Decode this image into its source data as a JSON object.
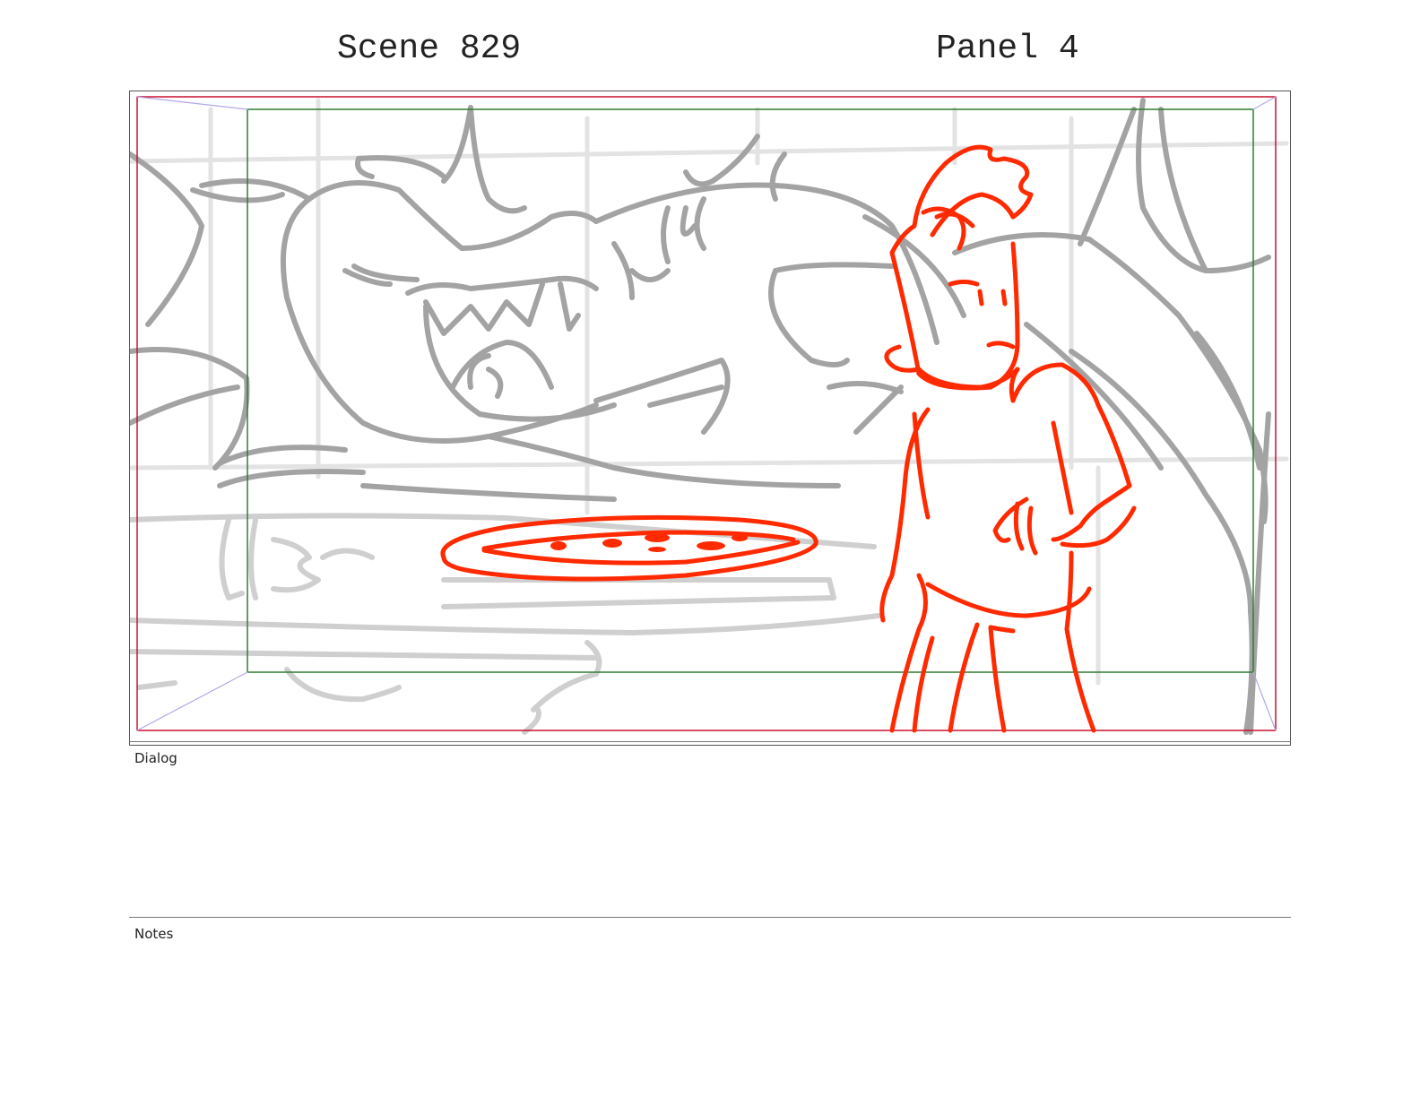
{
  "header": {
    "scene_label": "Scene 829",
    "panel_label": "Panel 4"
  },
  "panel": {
    "sketch_colors": {
      "background_lines": "#a3a3a3",
      "foreground_character": "#ff2a00",
      "safe_area_outer": "#c8102e",
      "safe_area_inner": "#2e7d32",
      "camera_guides": "#b3a6e6"
    }
  },
  "dialog": {
    "label": "Dialog",
    "text": ""
  },
  "notes": {
    "label": "Notes",
    "text": ""
  }
}
